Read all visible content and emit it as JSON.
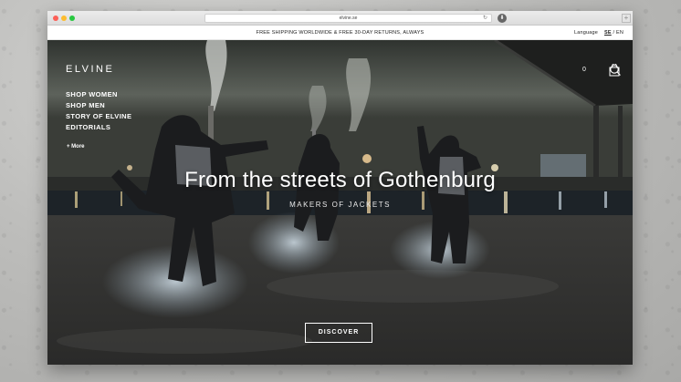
{
  "browser": {
    "url": "elvine.se"
  },
  "topbar": {
    "promo": "FREE SHIPPING WORLDWIDE & FREE 30-DAY RETURNS, ALWAYS",
    "language_label": "Language",
    "lang_active": "SE",
    "lang_separator": "/",
    "lang_other": "EN"
  },
  "header": {
    "logo": "ELVINE",
    "cart_count": "0"
  },
  "nav": {
    "items": [
      "SHOP WOMEN",
      "SHOP MEN",
      "STORY OF ELVINE",
      "EDITORIALS"
    ],
    "more": "+ More"
  },
  "hero": {
    "headline": "From the streets of Gothenburg",
    "subheadline": "MAKERS OF JACKETS",
    "cta": "DISCOVER"
  },
  "colors": {
    "accent": "#ffffff",
    "close": "#fc5f57",
    "minimize": "#fdbc2e",
    "maximize": "#28c840"
  }
}
